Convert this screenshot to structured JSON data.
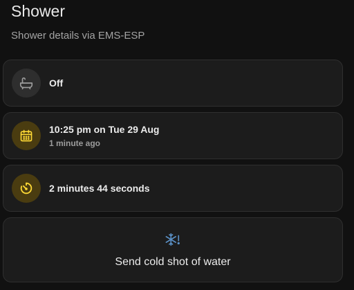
{
  "header": {
    "title": "Shower",
    "subtitle": "Shower details via EMS-ESP"
  },
  "tiles": [
    {
      "icon": "bathtub-icon",
      "primary": "Off",
      "secondary": ""
    },
    {
      "icon": "calendar-icon",
      "primary": "10:25 pm on Tue 29 Aug",
      "secondary": "1 minute ago"
    },
    {
      "icon": "timer-icon",
      "primary": "2 minutes 44 seconds",
      "secondary": ""
    }
  ],
  "action_button": {
    "icon": "snowflake-alert-icon",
    "label": "Send cold shot of water"
  },
  "colors": {
    "accent_amber": "#fdd835",
    "icon_blue": "#5a8fc4",
    "icon_off": "#9e9e9e"
  }
}
